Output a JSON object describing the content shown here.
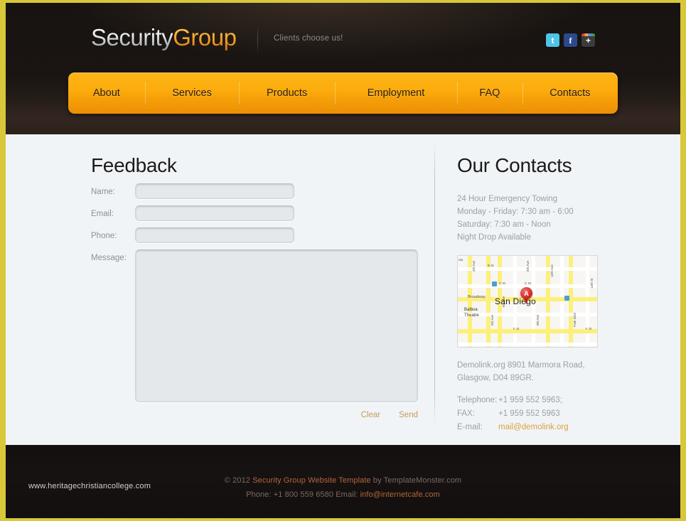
{
  "header": {
    "logo_primary": "Security",
    "logo_accent": "Group",
    "tagline": "Clients choose us!",
    "socials": [
      {
        "name": "twitter",
        "glyph": "t"
      },
      {
        "name": "facebook",
        "glyph": "f"
      },
      {
        "name": "google-plus",
        "glyph": "+"
      }
    ]
  },
  "nav": {
    "items": [
      {
        "label": "About"
      },
      {
        "label": "Services"
      },
      {
        "label": "Products"
      },
      {
        "label": "Employment"
      },
      {
        "label": "FAQ"
      },
      {
        "label": "Contacts"
      }
    ]
  },
  "feedback": {
    "title": "Feedback",
    "fields": [
      {
        "label": "Name:",
        "value": "",
        "placeholder": ""
      },
      {
        "label": "Email:",
        "value": "",
        "placeholder": ""
      },
      {
        "label": "Phone:",
        "value": "",
        "placeholder": ""
      },
      {
        "label": "Message:",
        "value": "",
        "placeholder": ""
      }
    ],
    "clear_label": "Clear",
    "send_label": "Send"
  },
  "contacts": {
    "title": "Our Contacts",
    "hours": [
      "24 Hour Emergency Towing",
      "Monday - Friday: 7:30 am - 6:00",
      "Saturday: 7:30 am - Noon",
      "Night Drop Available"
    ],
    "address_line1": "Demolink.org 8901 Marmora Road,",
    "address_line2": "Glasgow, D04 89GR.",
    "telephone_label": "Telephone:",
    "telephone_value": "+1 959 552 5963;",
    "fax_label": "FAX:",
    "fax_value": "+1 959 552 5963",
    "email_label": "E-mail:",
    "email_value": "mail@demolink.org"
  },
  "map": {
    "city_label": "San Diego",
    "marker_label": "A",
    "corner_label": "ola",
    "street_labels": [
      "4th Ave",
      "5th Ave",
      "6th Ave",
      "9th Ave",
      "10th Ave",
      "B St",
      "C St",
      "C St",
      "F St",
      "F St",
      "Broadway",
      "Park Blvd",
      "14th St"
    ],
    "poi_label_line1": "Balboa",
    "poi_label_line2": "Theatre"
  },
  "footer": {
    "copyright_prefix": "© 2012 ",
    "copyright_link": "Security Group Website Template",
    "copyright_suffix": " by TemplateMonster.com",
    "phone_label": "Phone: ",
    "phone_value": "+1 800 559 6580",
    "email_label": "  Email: ",
    "email_value": "info@internetcafe.com",
    "watermark": "www.heritagechristiancollege.com"
  },
  "colors": {
    "accent_orange": "#fcab0c",
    "link_orange": "#d8a23f",
    "page_border": "#d9c73a",
    "content_bg": "#f1f4f7"
  }
}
